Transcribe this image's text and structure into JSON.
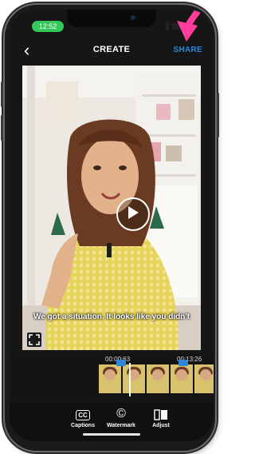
{
  "status_bar": {
    "time": "12:52"
  },
  "header": {
    "back_icon": "chevron-left-icon",
    "title": "CREATE",
    "share_label": "SHARE",
    "annotation_arrow_color": "#ff3d9a"
  },
  "video": {
    "caption": "We got a situation. It looks like you didn't",
    "play_icon": "play-icon",
    "expand_icon": "expand-icon"
  },
  "timeline": {
    "start_time": "00:00:63",
    "end_time": "00:13:26",
    "accent_color": "#2e87d6"
  },
  "toolbar": {
    "items": [
      {
        "label": "Captions",
        "icon": "cc-icon",
        "glyph": "CC"
      },
      {
        "label": "Watermark",
        "icon": "copyright-icon",
        "glyph": "©"
      },
      {
        "label": "Adjust",
        "icon": "adjust-icon",
        "glyph": ""
      }
    ]
  }
}
